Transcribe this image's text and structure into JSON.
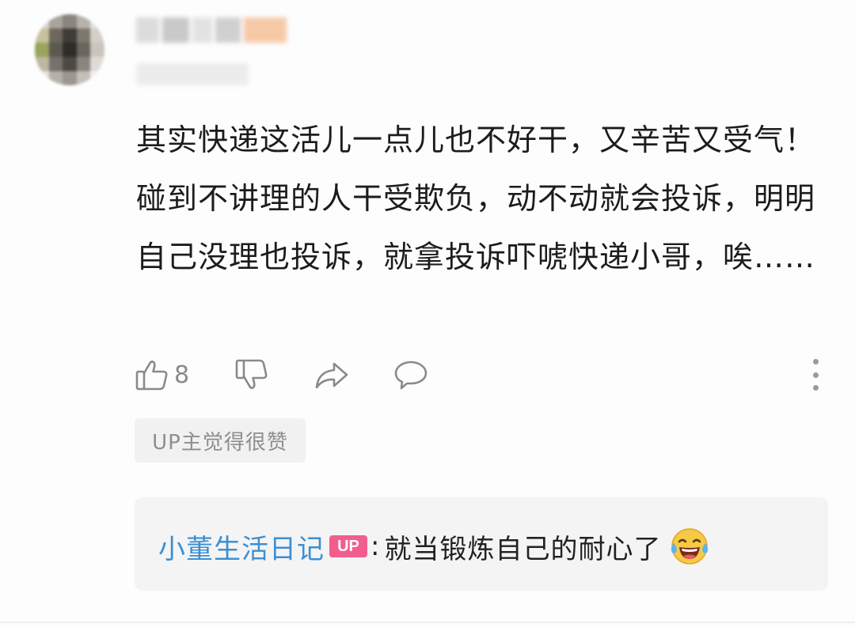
{
  "comment": {
    "text": "其实快递这活儿一点儿也不好干，又辛苦又受气！碰到不讲理的人干受欺负，动不动就会投诉，明明自己没理也投诉，就拿投诉吓唬快递小哥，唉……",
    "like_count": "8",
    "up_liked_note": "UP主觉得很赞"
  },
  "reply": {
    "author": "小董生活日记",
    "badge": "UP",
    "separator": ":",
    "text": "就当锻炼自己的耐心了",
    "emoji_icon": "laughing-tears-emoji"
  },
  "icons": {
    "like": "thumbs-up-icon",
    "dislike": "thumbs-down-icon",
    "share": "share-icon",
    "reply": "comment-bubble-icon",
    "more": "more-vertical-icon"
  },
  "colors": {
    "author_link": "#3b8fd4",
    "up_badge": "#f25d8e",
    "icon_gray": "#8a8a8a"
  }
}
